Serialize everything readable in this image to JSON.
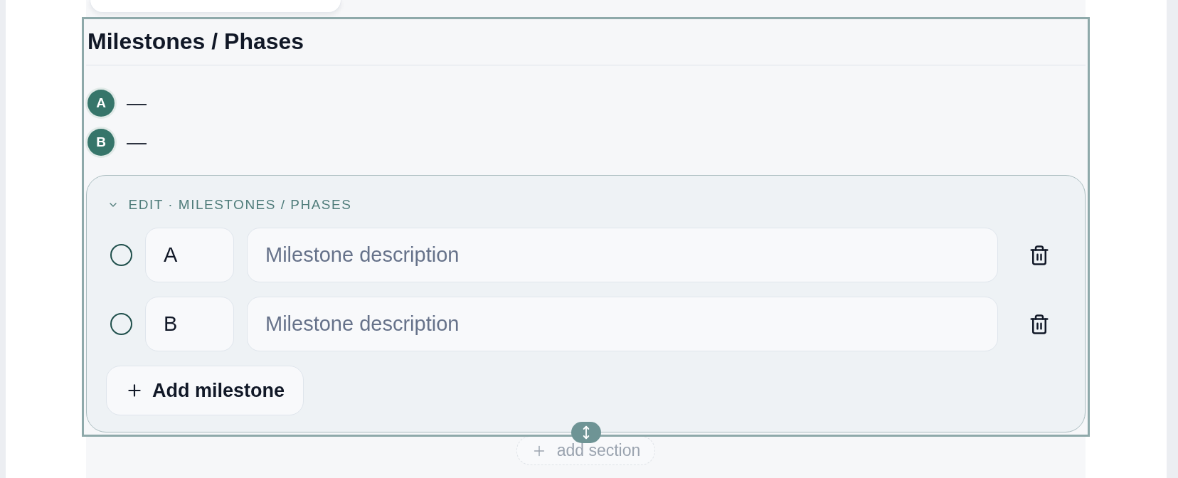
{
  "section": {
    "title": "Milestones / Phases",
    "selected": true
  },
  "milestones": [
    {
      "badge": "A",
      "text": "—"
    },
    {
      "badge": "B",
      "text": "—"
    }
  ],
  "edit_panel": {
    "title": "EDIT · MILESTONES / PHASES",
    "expanded": true,
    "rows": [
      {
        "selected": false,
        "code": "A",
        "placeholder": "Milestone description"
      },
      {
        "selected": false,
        "code": "B",
        "placeholder": "Milestone description"
      }
    ],
    "add_button": "Add milestone"
  },
  "add_section": "add section"
}
